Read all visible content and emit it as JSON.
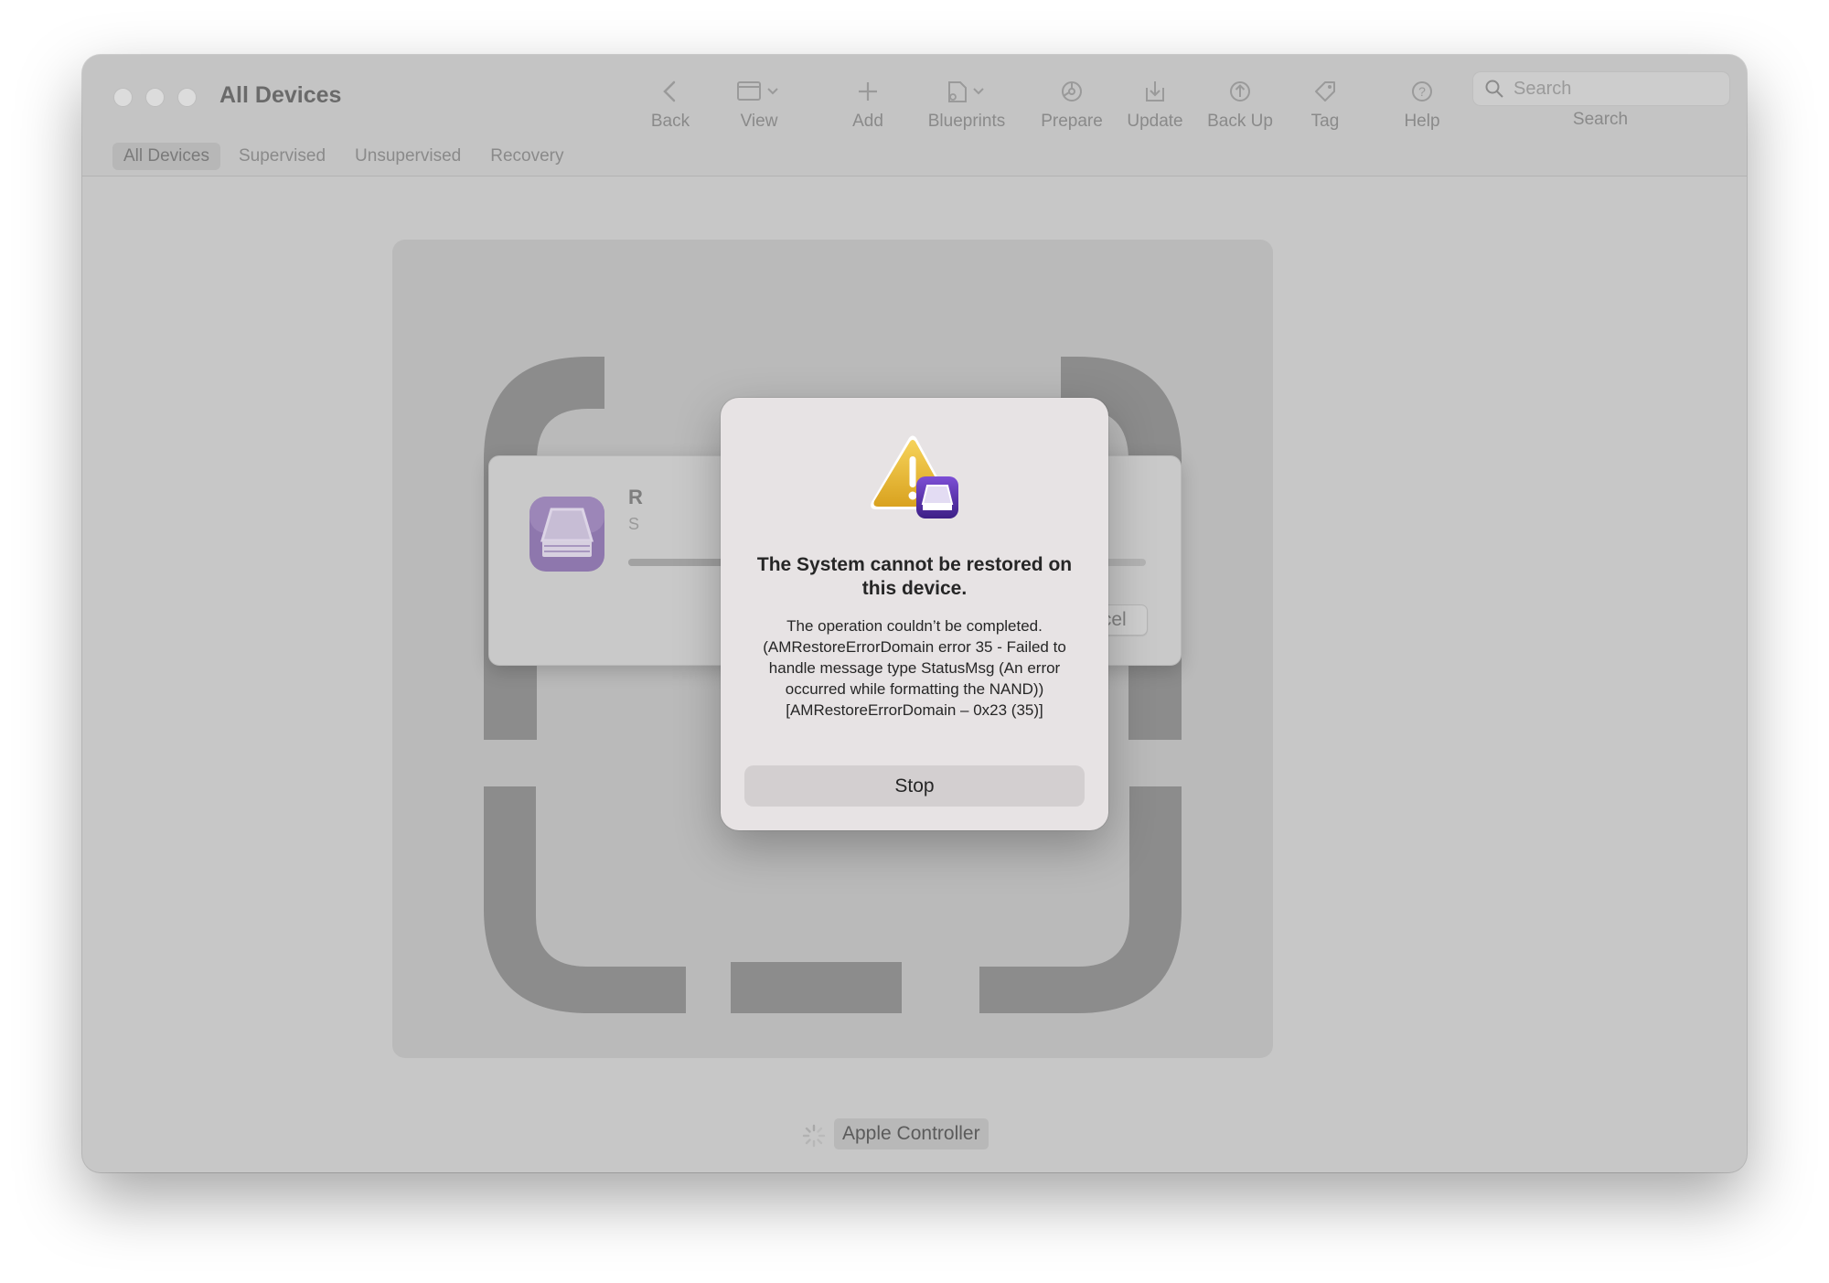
{
  "window": {
    "title": "All Devices"
  },
  "toolbar": {
    "back": "Back",
    "view": "View",
    "add": "Add",
    "blueprints": "Blueprints",
    "prepare": "Prepare",
    "update": "Update",
    "backup": "Back Up",
    "tag": "Tag",
    "help": "Help",
    "search_placeholder": "Search",
    "search_label": "Search"
  },
  "tabs": [
    {
      "label": "All Devices",
      "active": true
    },
    {
      "label": "Supervised"
    },
    {
      "label": "Unsupervised"
    },
    {
      "label": "Recovery"
    }
  ],
  "progress_sheet": {
    "title_visible": "R",
    "subtitle_visible": "S",
    "cancel_label": "Cancel",
    "progress": 0.9
  },
  "alert": {
    "icon": "warning-with-configurator-icon",
    "title": "The System cannot be restored on this device.",
    "message": "The operation couldn’t be completed. (AMRestoreErrorDomain error 35 - Failed to handle message type StatusMsg (An error occurred while formatting the NAND)) [AMRestoreErrorDomain – 0x23 (35)]",
    "button": "Stop"
  },
  "device": {
    "name": "Apple Controller"
  },
  "colors": {
    "warning": "#f2c23a",
    "configurator_purple": "#5b2fae"
  }
}
